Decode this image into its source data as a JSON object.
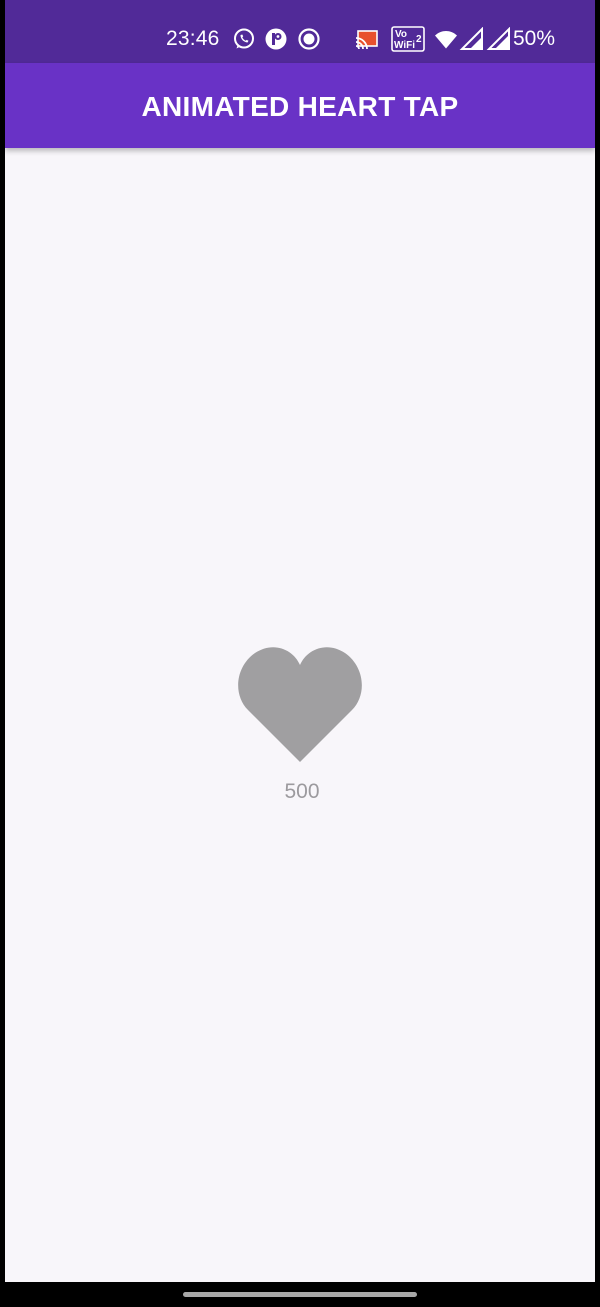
{
  "status_bar": {
    "time": "23:46",
    "battery": "50%",
    "icons": [
      "whatsapp-icon",
      "app-notification-icon",
      "record-icon",
      "cast-icon",
      "vowifi-icon",
      "wifi-icon",
      "signal-icon",
      "signal-icon-2"
    ],
    "vowifi_label_top": "Vo",
    "vowifi_label_bottom": "WiFi",
    "vowifi_sim": "2"
  },
  "app_bar": {
    "title": "ANIMATED HEART TAP",
    "color": "#6932c6"
  },
  "main": {
    "heart": {
      "icon": "heart-icon",
      "color": "#a09fa1",
      "liked": false
    },
    "like_count": "500"
  },
  "colors": {
    "status_bar": "#512a98",
    "background": "#f8f6fa",
    "count_text": "#9c9a9e"
  }
}
